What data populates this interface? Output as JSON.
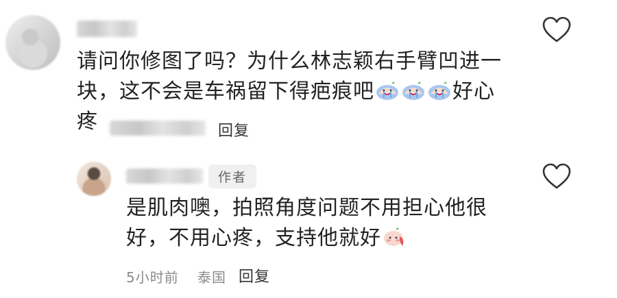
{
  "comments": [
    {
      "text_line1": "请问你修图了吗？为什么林志颖右手臂凹进一",
      "text_line2": "块，这不会是车祸留下得疤痕吧",
      "text_after_emoji": "好心",
      "text_line3": "疼",
      "emojis": [
        "crying-emoji",
        "crying-emoji",
        "crying-emoji"
      ],
      "reply_label": "回复",
      "like_icon": "heart-outline-icon"
    },
    {
      "author_badge": "作者",
      "text_line1": "是肌肉噢，拍照角度问题不用担心他很",
      "text_line2": "好，不用心疼，支持他就好",
      "emoji": "blush-emoji",
      "time": "5小时前",
      "location": "泰国",
      "reply_label": "回复",
      "like_icon": "heart-outline-icon"
    }
  ],
  "colors": {
    "text": "#222222",
    "meta": "#8a8a8a",
    "badge_bg": "#f0f0f0",
    "emoji_blue": "#a9c7ee",
    "emoji_red": "#e05a5a"
  }
}
